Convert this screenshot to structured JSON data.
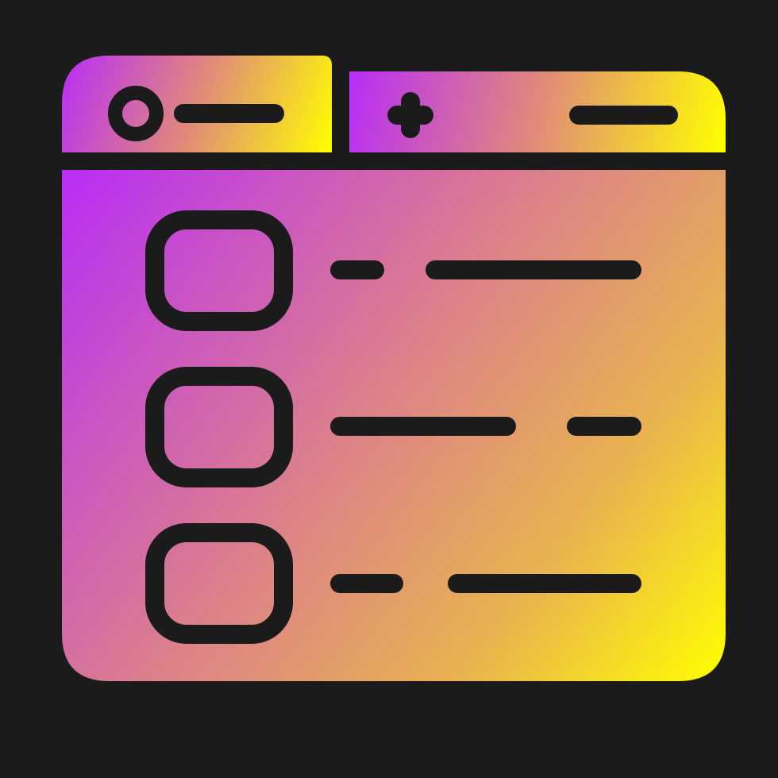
{
  "icon": {
    "name": "browser-window-checklist-icon",
    "colors": {
      "background": "#1b1b1b",
      "outline": "#1b1b1b",
      "gradient_start": "#b92df7",
      "gradient_mid": "#e08a7a",
      "gradient_end": "#ffff00"
    },
    "tabs": [
      {
        "name": "active-tab",
        "glyph": "circle-icon"
      },
      {
        "name": "new-tab",
        "glyph": "plus-icon"
      }
    ],
    "checklist": {
      "row_count": 3,
      "rows": [
        {
          "checked": false
        },
        {
          "checked": false
        },
        {
          "checked": false
        }
      ]
    }
  }
}
